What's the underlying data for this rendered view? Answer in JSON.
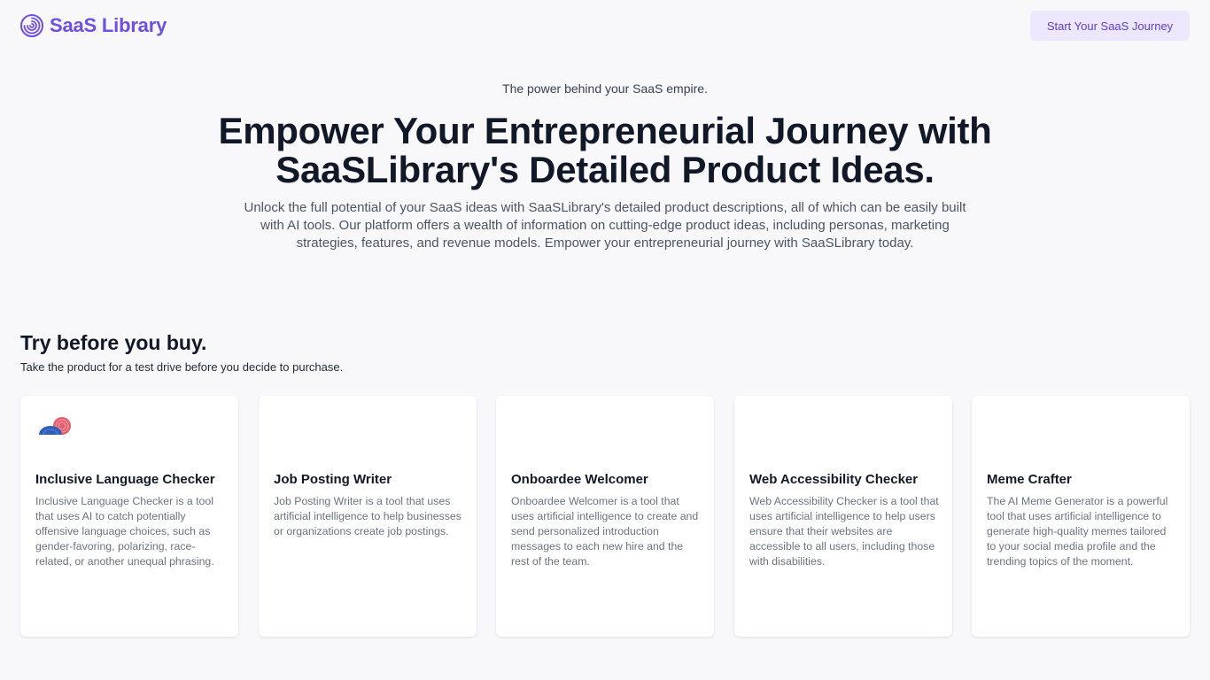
{
  "brand": {
    "name": "SaaS Library",
    "color": "#6d4fe3",
    "icon": "fingerprint-spiral-icon"
  },
  "header": {
    "cta_label": "Start Your SaaS Journey"
  },
  "hero": {
    "tagline": "The power behind your SaaS empire.",
    "title": "Empower Your Entrepreneurial Journey with SaaSLibrary's Detailed Product Ideas.",
    "description": "Unlock the full potential of your SaaS ideas with SaaSLibrary's detailed product descriptions, all of which can be easily built with AI tools. Our platform offers a wealth of information on cutting-edge product ideas, including personas, marketing strategies, features, and revenue models. Empower your entrepreneurial journey with SaaSLibrary today."
  },
  "section": {
    "title": "Try before you buy.",
    "subtitle": "Take the product for a test drive before you decide to purchase."
  },
  "products": [
    {
      "title": "Inclusive Language Checker",
      "description": "Inclusive Language Checker is a tool that uses AI to catch potentially offensive language choices, such as gender-favoring, polarizing, race-related, or another unequal phrasing.",
      "icon": "speech-bubbles-icon"
    },
    {
      "title": "Job Posting Writer",
      "description": "Job Posting Writer is a tool that uses artificial intelligence to help businesses or organizations create job postings."
    },
    {
      "title": "Onboardee Welcomer",
      "description": "Onboardee Welcomer is a tool that uses artificial intelligence to create and send personalized introduction messages to each new hire and the rest of the team."
    },
    {
      "title": "Web Accessibility Checker",
      "description": "Web Accessibility Checker is a tool that uses artificial intelligence to help users ensure that their websites are accessible to all users, including those with disabilities."
    },
    {
      "title": "Meme Crafter",
      "description": "The AI Meme Generator is a powerful tool that uses artificial intelligence to generate high-quality memes tailored to your social media profile and the trending topics of the moment."
    }
  ]
}
